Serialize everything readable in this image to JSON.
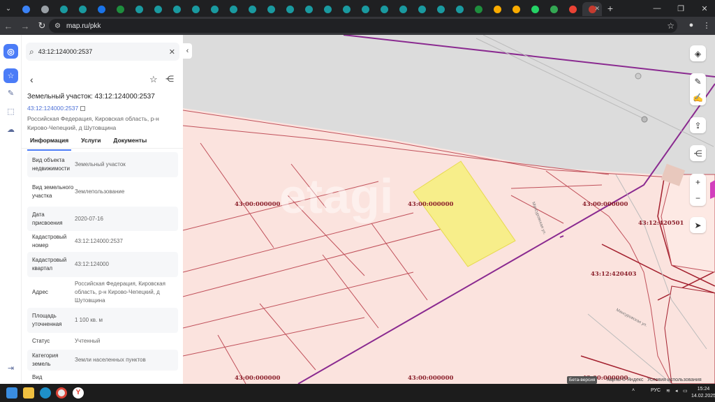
{
  "browser": {
    "tabs": [
      {
        "icon": "globe-icon",
        "color": "#3b82f6"
      },
      {
        "icon": "chrome-icon",
        "color": "#9aa0a6"
      },
      {
        "icon": "globe-icon",
        "color": "#1a9aa0"
      },
      {
        "icon": "globe-icon",
        "color": "#1a9aa0"
      },
      {
        "icon": "globe-icon",
        "color": "#1a73e8"
      },
      {
        "icon": "sheets-icon",
        "color": "#1e8e3e"
      },
      {
        "icon": "globe-icon",
        "color": "#1a9aa0"
      },
      {
        "icon": "globe-icon",
        "color": "#1a9aa0"
      },
      {
        "icon": "globe-icon",
        "color": "#1a9aa0"
      },
      {
        "icon": "globe-icon",
        "color": "#1a9aa0"
      },
      {
        "icon": "globe-icon",
        "color": "#1a9aa0"
      },
      {
        "icon": "globe-icon",
        "color": "#1a9aa0"
      },
      {
        "icon": "globe-icon",
        "color": "#1a9aa0"
      },
      {
        "icon": "globe-icon",
        "color": "#1a9aa0"
      },
      {
        "icon": "globe-icon",
        "color": "#1a9aa0"
      },
      {
        "icon": "globe-icon",
        "color": "#1a9aa0"
      },
      {
        "icon": "globe-icon",
        "color": "#1a9aa0"
      },
      {
        "icon": "globe-icon",
        "color": "#1a9aa0"
      },
      {
        "icon": "globe-icon",
        "color": "#1a9aa0"
      },
      {
        "icon": "globe-icon",
        "color": "#1a9aa0"
      },
      {
        "icon": "globe-icon",
        "color": "#1a9aa0"
      },
      {
        "icon": "globe-icon",
        "color": "#1a9aa0"
      },
      {
        "icon": "globe-icon",
        "color": "#1a9aa0"
      },
      {
        "icon": "globe-icon",
        "color": "#1a9aa0"
      },
      {
        "icon": "sheets-icon",
        "color": "#1e8e3e"
      },
      {
        "icon": "bookmark-icon",
        "color": "#f9ab00"
      },
      {
        "icon": "bookmark-icon",
        "color": "#f9ab00"
      },
      {
        "icon": "whatsapp-icon",
        "color": "#25d366"
      },
      {
        "icon": "map-icon",
        "color": "#34a853"
      },
      {
        "icon": "maps-pin-icon",
        "color": "#ea4335"
      },
      {
        "icon": "active-tab-icon",
        "color": "#c53b2f"
      }
    ],
    "url": "map.ru/pkk"
  },
  "panel": {
    "search_value": "43:12:124000:2537",
    "title": "Земельный участок: 43:12:124000:2537",
    "cad_link": "43:12:124000:2537",
    "address_line": "Российская Федерация, Кировская область, р-н Кирово-Чепецкий, д Шутовщина",
    "tabs": [
      "Информация",
      "Услуги",
      "Документы"
    ],
    "rows": [
      {
        "k": "Вид объекта недвижимости",
        "v": "Земельный участок"
      },
      {
        "k": "Вид земельного участка",
        "v": "Землепользование"
      },
      {
        "k": "Дата присвоения",
        "v": "2020-07-16"
      },
      {
        "k": "Кадастровый номер",
        "v": "43:12:124000:2537"
      },
      {
        "k": "Кадастровый квартал",
        "v": "43:12:124000"
      },
      {
        "k": "Адрес",
        "v": "Российская Федерация, Кировская область, р-н Кирово-Чепецкий, д Шутовщина"
      },
      {
        "k": "Площадь уточненная",
        "v": "1 100 кв. м"
      },
      {
        "k": "Статус",
        "v": "Учтенный"
      },
      {
        "k": "Категория земель",
        "v": "Земли населенных пунктов"
      },
      {
        "k": "Вид",
        "v": ""
      }
    ]
  },
  "map": {
    "labels": [
      "43:00:000000",
      "43:00:000000",
      "43:00:000000",
      "43:12:420501",
      "43:12:420403",
      "43:00:000000",
      "43:00:000000",
      "43:00:000000"
    ],
    "watermark": "etagi",
    "streets": [
      "Мансуровская ул.",
      "Мансуровская ул."
    ],
    "attribution": {
      "beta": "Бета-версия",
      "yandex": "Карты © Яндекс",
      "terms": "Условия использования"
    },
    "colors": {
      "parcel_fill": "#fbe3de",
      "parcel_line": "#c0505a",
      "selected_fill": "#f7ee8a",
      "boundary": "#8a2a90",
      "road_fill": "#d9d9d9"
    }
  },
  "taskbar": {
    "lang": "РУС",
    "time": "15:24",
    "date": "14.02.2025"
  }
}
